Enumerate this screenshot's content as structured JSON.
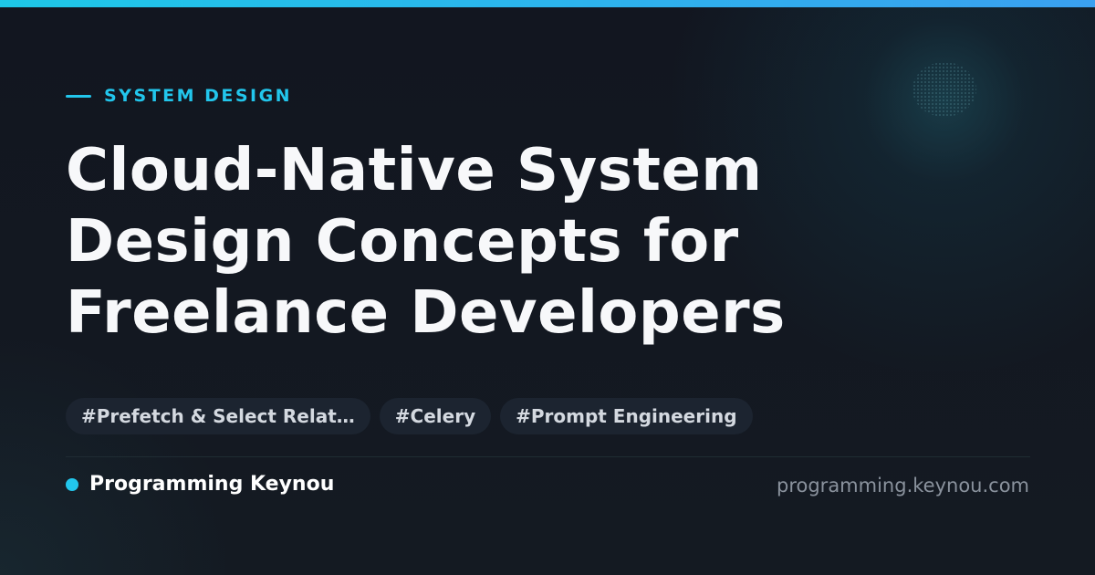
{
  "category": "SYSTEM DESIGN",
  "title_lines": [
    "Cloud-Native System",
    "Design Concepts for",
    "Freelance Developers"
  ],
  "tags": [
    "#Prefetch & Select Relat…",
    "#Celery",
    "#Prompt Engineering"
  ],
  "brand": {
    "name": "Programming Keynou",
    "dot_icon": "dot-icon"
  },
  "site_url": "programming.keynou.com",
  "colors": {
    "accent": "#22c6ec",
    "background": "#12161f",
    "tag_background": "#1c2430",
    "title": "#f7f8fa",
    "muted": "#8a929d"
  }
}
